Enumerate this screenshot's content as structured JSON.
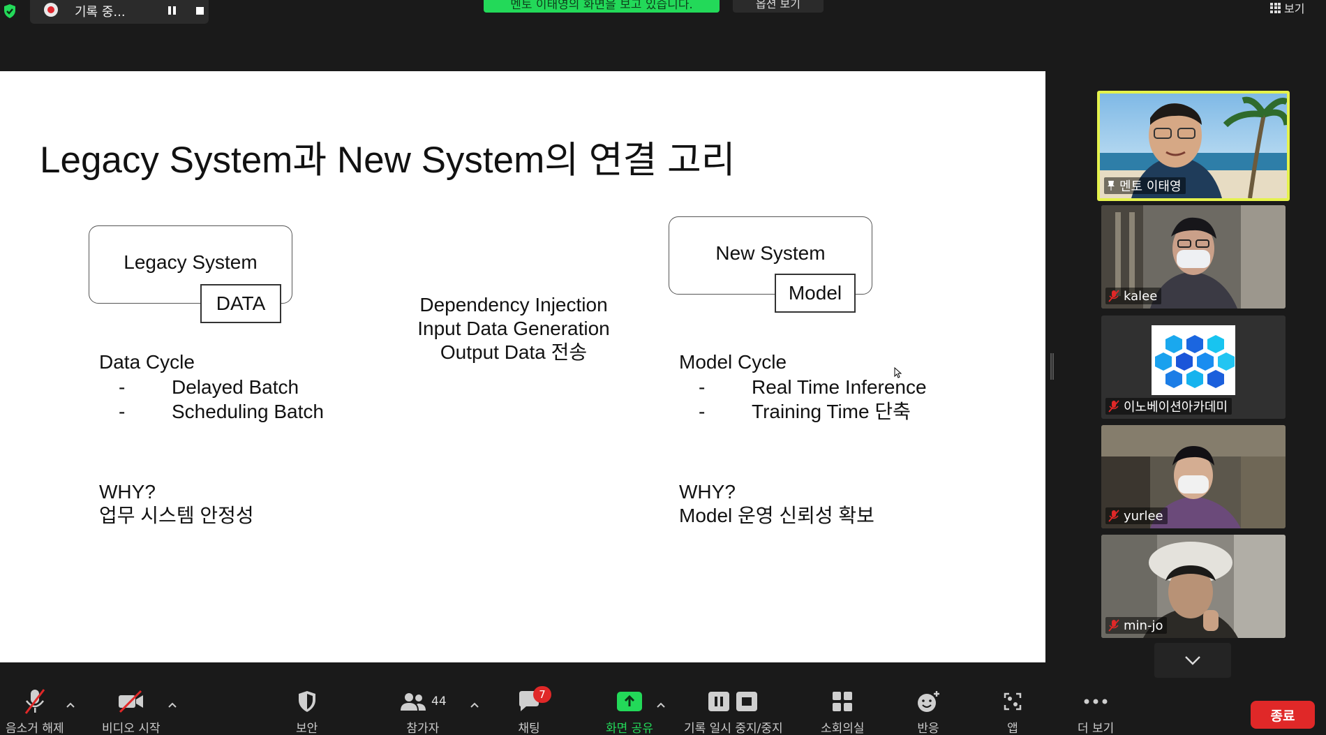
{
  "top_bar": {
    "recording_label": "기록 중...",
    "share_banner": "멘토 이태영의 화면을 보고 있습니다.",
    "view_options": "옵션 보기",
    "view_button": "보기"
  },
  "slide": {
    "title": "Legacy System과 New System의 연결 고리",
    "legacy_box": {
      "label": "Legacy System",
      "tag": "DATA"
    },
    "new_box": {
      "label": "New System",
      "tag": "Model"
    },
    "center_lines": [
      "Dependency Injection",
      "Input Data Generation",
      "Output Data 전송"
    ],
    "left_cycle": {
      "title": "Data Cycle",
      "items": [
        "Delayed Batch",
        "Scheduling Batch"
      ]
    },
    "right_cycle": {
      "title": "Model Cycle",
      "items": [
        "Real Time Inference",
        "Training Time 단축"
      ]
    },
    "left_why": {
      "q": "WHY?",
      "a": "업무 시스템 안정성"
    },
    "right_why": {
      "q": "WHY?",
      "a": "Model 운영 신뢰성 확보"
    }
  },
  "participants": [
    {
      "name": "멘토 이태영",
      "pinned": true,
      "muted": false
    },
    {
      "name": "kalee",
      "pinned": false,
      "muted": true
    },
    {
      "name": "이노베이션아카데미",
      "pinned": false,
      "muted": true
    },
    {
      "name": "yurlee",
      "pinned": false,
      "muted": true
    },
    {
      "name": "min-jo",
      "pinned": false,
      "muted": true
    }
  ],
  "toolbar": {
    "unmute": "음소거 해제",
    "video_start": "비디오 시작",
    "security": "보안",
    "participants": "참가자",
    "participants_count": "44",
    "chat": "채팅",
    "chat_badge": "7",
    "share_screen": "화면 공유",
    "pause_stop_recording": "기록 일시 중지/중지",
    "breakout_rooms": "소회의실",
    "reactions": "반응",
    "apps": "앱",
    "more": "더 보기",
    "end": "종료"
  },
  "colors": {
    "share_green": "#23d959",
    "end_red": "#e02828",
    "active_speaker": "#e5f24c",
    "muted_red": "#e02828"
  }
}
